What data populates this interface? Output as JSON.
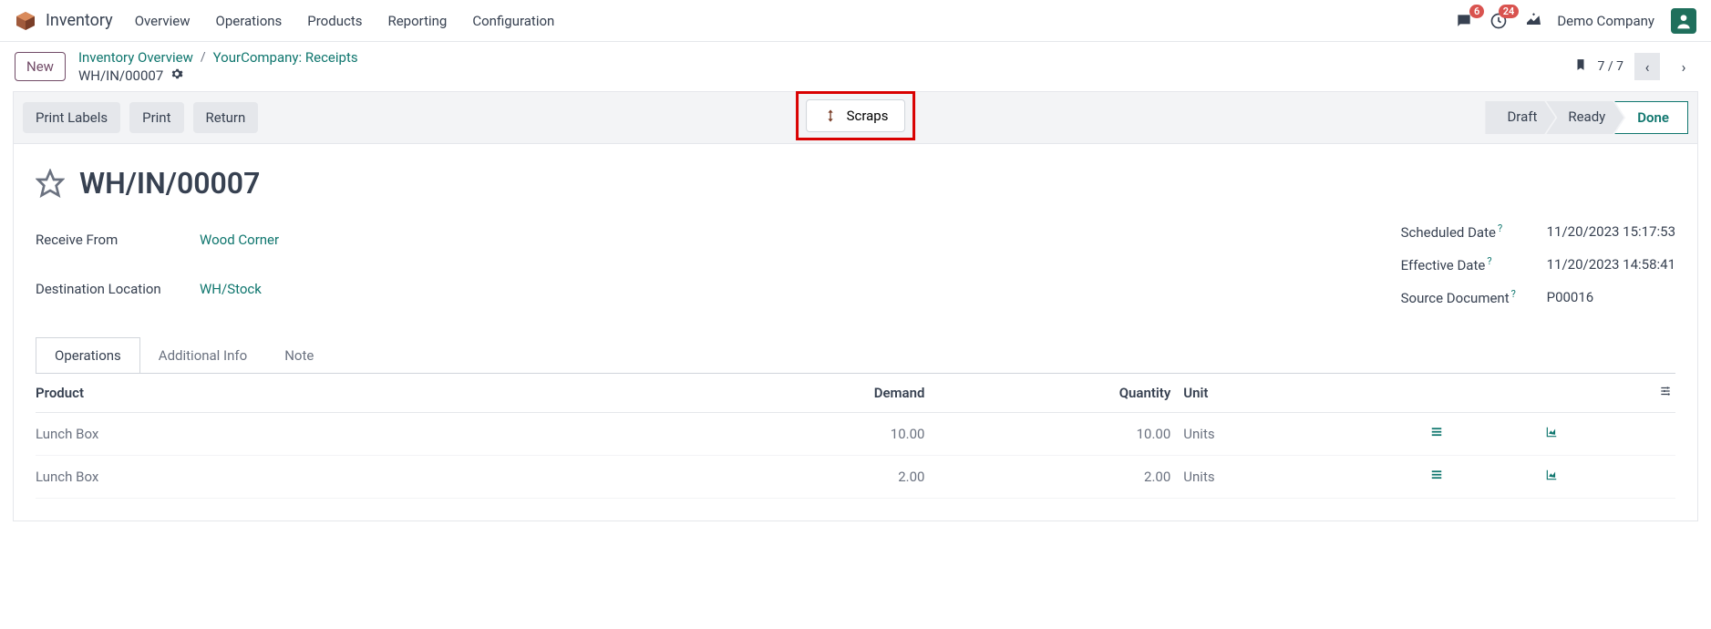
{
  "topbar": {
    "app": "Inventory",
    "menu": [
      "Overview",
      "Operations",
      "Products",
      "Reporting",
      "Configuration"
    ],
    "chat_badge": "6",
    "activity_badge": "24",
    "company": "Demo Company"
  },
  "controls": {
    "new": "New",
    "breadcrumb": {
      "a": "Inventory Overview",
      "b": "YourCompany: Receipts",
      "current": "WH/IN/00007"
    },
    "scraps": "Scraps",
    "pager": "7 / 7"
  },
  "actionbar": {
    "print_labels": "Print Labels",
    "print": "Print",
    "return": "Return",
    "status": {
      "draft": "Draft",
      "ready": "Ready",
      "done": "Done"
    }
  },
  "record": {
    "title": "WH/IN/00007",
    "labels": {
      "receive_from": "Receive From",
      "dest": "Destination Location",
      "scheduled": "Scheduled Date",
      "effective": "Effective Date",
      "source": "Source Document"
    },
    "receive_from": "Wood Corner",
    "dest": "WH/Stock",
    "scheduled": "11/20/2023 15:17:53",
    "effective": "11/20/2023 14:58:41",
    "source": "P00016"
  },
  "tabs": {
    "operations": "Operations",
    "addl": "Additional Info",
    "note": "Note"
  },
  "table": {
    "headers": {
      "product": "Product",
      "demand": "Demand",
      "quantity": "Quantity",
      "unit": "Unit"
    },
    "rows": [
      {
        "product": "Lunch Box",
        "demand": "10.00",
        "quantity": "10.00",
        "unit": "Units"
      },
      {
        "product": "Lunch Box",
        "demand": "2.00",
        "quantity": "2.00",
        "unit": "Units"
      }
    ]
  }
}
